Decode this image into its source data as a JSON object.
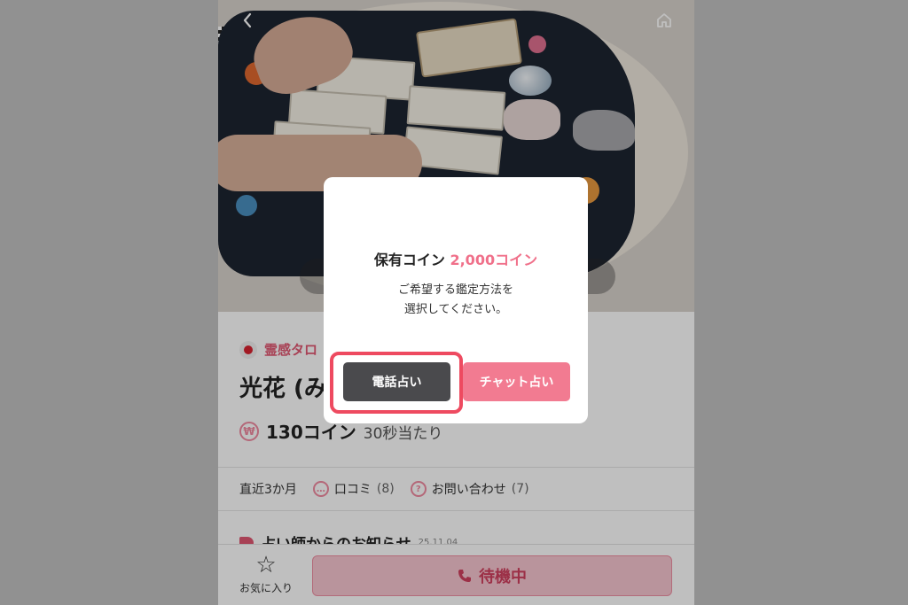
{
  "header": {
    "back_icon": "chevron-left-icon",
    "home_icon": "home-icon"
  },
  "profile": {
    "category": "霊感タロ",
    "name": "光花 (み",
    "price_coin_icon": "₩",
    "price_amount": "130コイン",
    "price_per": "30秒当たり"
  },
  "stats": {
    "period": "直近3か月",
    "reviews_label": "口コミ",
    "reviews_count": "(8)",
    "inquiries_label": "お問い合わせ",
    "inquiries_count": "(7)"
  },
  "notice": {
    "title": "占い師からのお知らせ",
    "date": "25.11.04"
  },
  "bottom_bar": {
    "favorite_label": "お気に入り",
    "wait_label": "待機中"
  },
  "modal": {
    "title_prefix": "保有コイン ",
    "title_coins": "2,000コイン",
    "message_line1": "ご希望する鑑定方法を",
    "message_line2": "選択してください。",
    "phone_button": "電話占い",
    "chat_button": "チャット占い"
  },
  "colors": {
    "accent_pink": "#f27b91",
    "dark_button": "#4a4a4d",
    "highlight_red": "#ee4a60"
  }
}
